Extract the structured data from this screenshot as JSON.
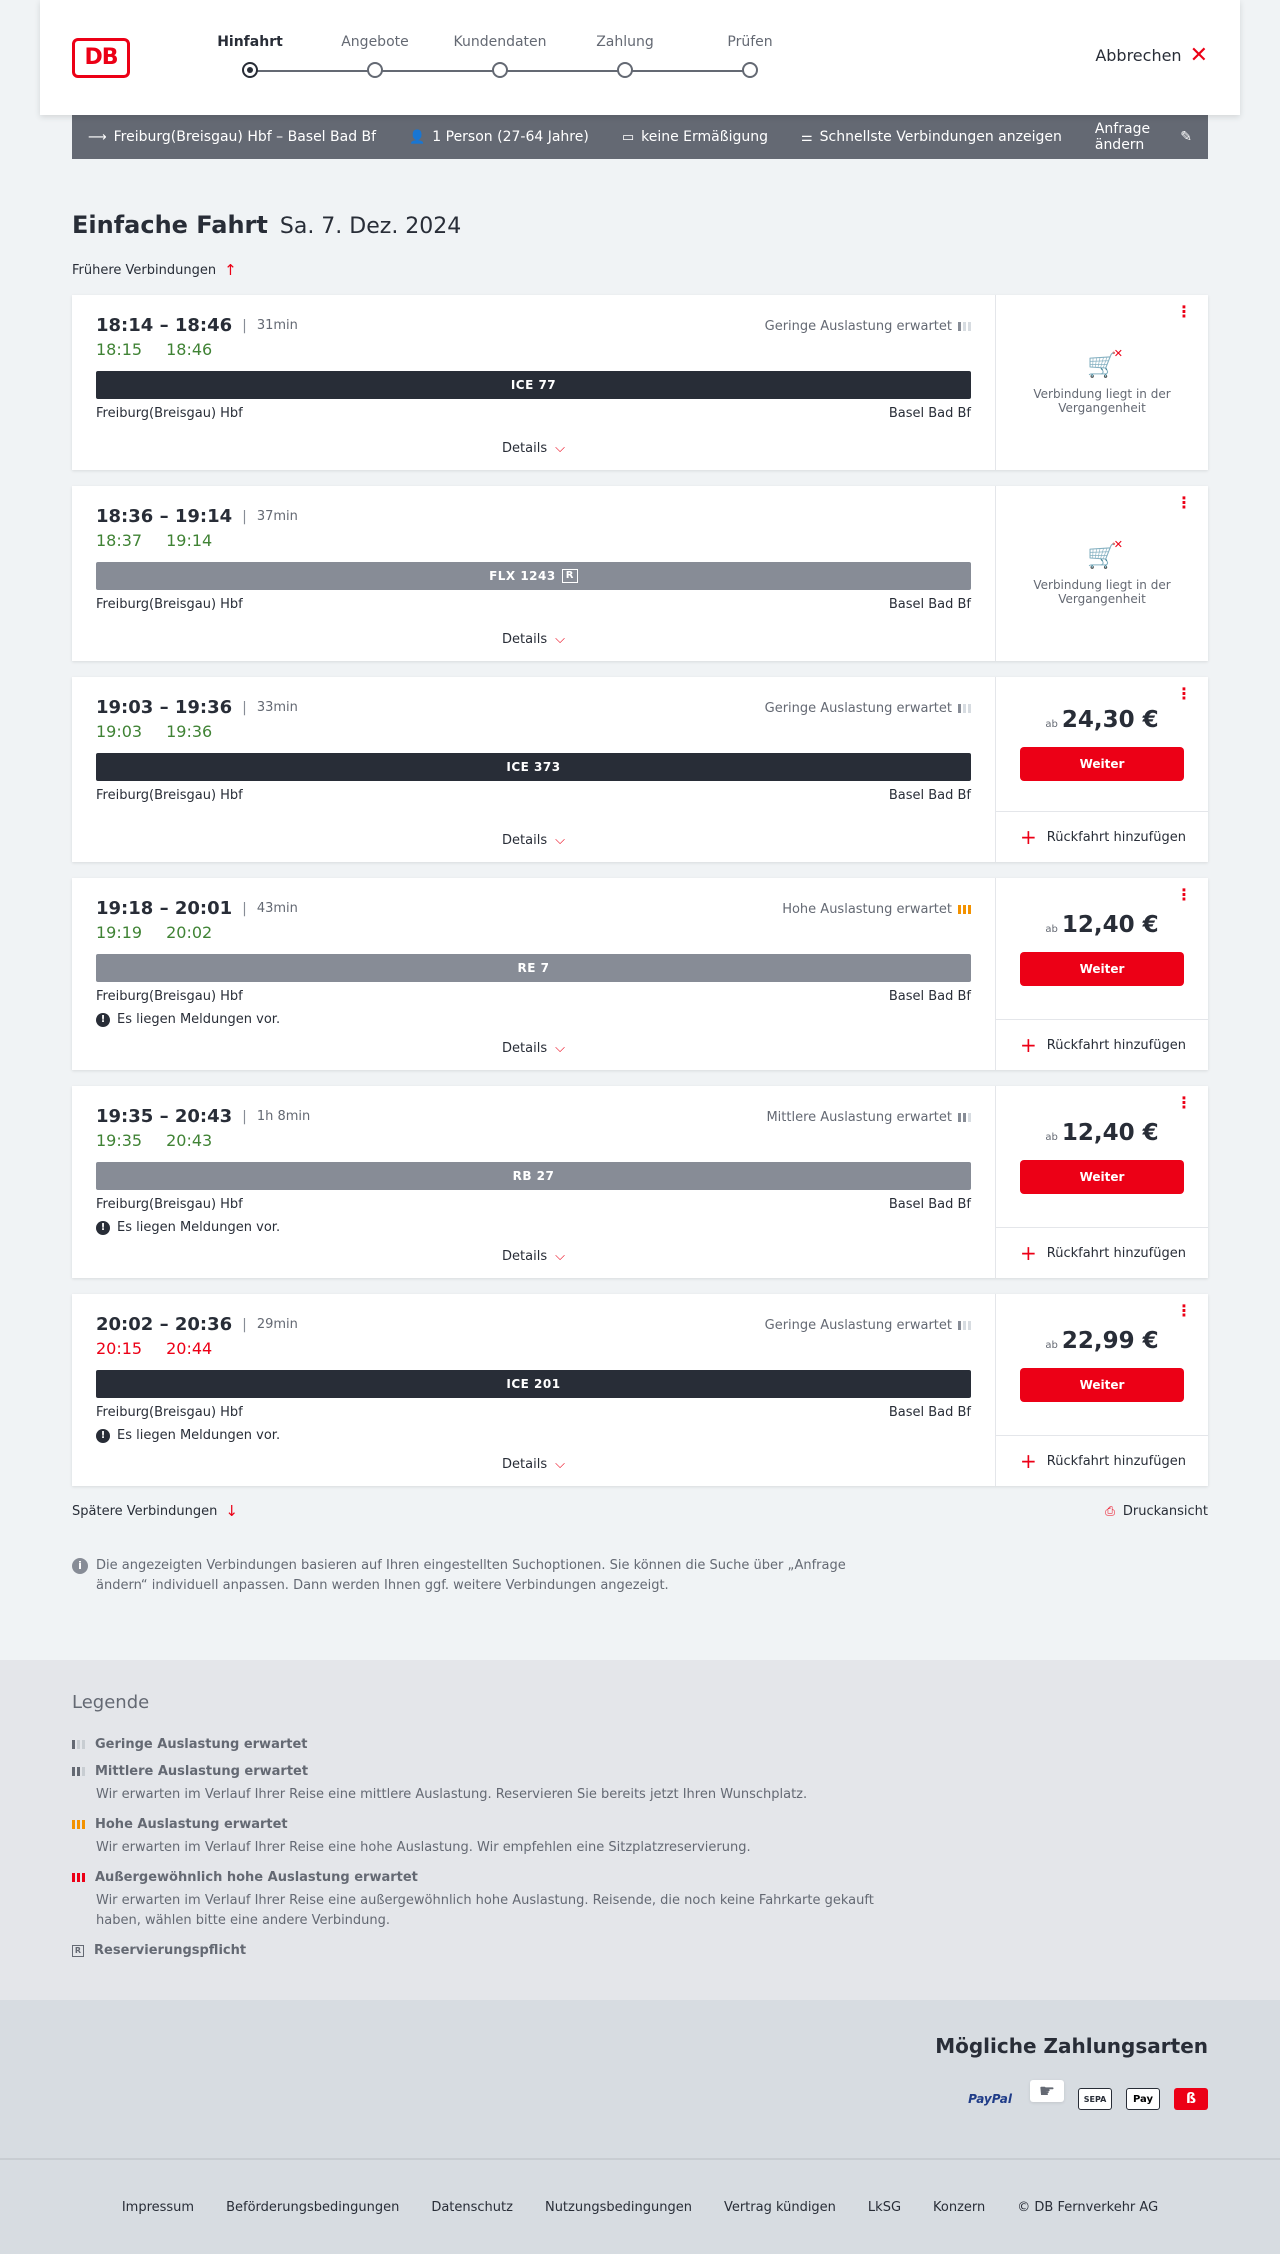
{
  "header": {
    "logo": "DB",
    "steps": [
      "Hinfahrt",
      "Angebote",
      "Kundendaten",
      "Zahlung",
      "Prüfen"
    ],
    "cancel_label": "Abbrechen"
  },
  "query": {
    "route": "Freiburg(Breisgau) Hbf – Basel Bad Bf",
    "passengers": "1 Person (27-64 Jahre)",
    "discount": "keine Ermäßigung",
    "option": "Schnellste Verbindungen anzeigen",
    "change_label": "Anfrage ändern"
  },
  "title": "Einfache Fahrt",
  "date": "Sa. 7. Dez. 2024",
  "earlier_label": "Frühere Verbindungen",
  "later_label": "Spätere Verbindungen",
  "print_label": "Druckansicht",
  "details_label": "Details",
  "price_prefix": "ab",
  "weiter_label": "Weiter",
  "return_label": "Rückfahrt hinzufügen",
  "past_text": "Verbindung liegt in der Vergangenheit",
  "message_text": "Es liegen Meldungen vor.",
  "connections": [
    {
      "times": "18:14 – 18:46",
      "duration": "31min",
      "rt_dep": "18:15",
      "rt_arr": "18:46",
      "rt_status": "ok",
      "load": "Geringe Auslastung erwartet",
      "train": "ICE 77",
      "from": "Freiburg(Breisgau) Hbf",
      "to": "Basel Bad Bf"
    },
    {
      "times": "18:36 – 19:14",
      "duration": "37min",
      "rt_dep": "18:37",
      "rt_arr": "19:14",
      "rt_status": "ok",
      "load": "",
      "train": "FLX 1243",
      "from": "Freiburg(Breisgau) Hbf",
      "to": "Basel Bad Bf"
    },
    {
      "times": "19:03 – 19:36",
      "duration": "33min",
      "rt_dep": "19:03",
      "rt_arr": "19:36",
      "rt_status": "ok",
      "load": "Geringe Auslastung erwartet",
      "train": "ICE 373",
      "from": "Freiburg(Breisgau) Hbf",
      "to": "Basel Bad Bf",
      "price": "24,30 €"
    },
    {
      "times": "19:18 – 20:01",
      "duration": "43min",
      "rt_dep": "19:19",
      "rt_arr": "20:02",
      "rt_status": "ok",
      "load": "Hohe Auslastung erwartet",
      "train": "RE 7",
      "from": "Freiburg(Breisgau) Hbf",
      "to": "Basel Bad Bf",
      "price": "12,40 €"
    },
    {
      "times": "19:35 – 20:43",
      "duration": "1h 8min",
      "rt_dep": "19:35",
      "rt_arr": "20:43",
      "rt_status": "ok",
      "load": "Mittlere Auslastung erwartet",
      "train": "RB 27",
      "from": "Freiburg(Breisgau) Hbf",
      "to": "Basel Bad Bf",
      "price": "12,40 €"
    },
    {
      "times": "20:02 – 20:36",
      "duration": "29min",
      "rt_dep": "20:15",
      "rt_arr": "20:44",
      "rt_status": "late",
      "load": "Geringe Auslastung erwartet",
      "train": "ICE 201",
      "from": "Freiburg(Breisgau) Hbf",
      "to": "Basel Bad Bf",
      "price": "22,99 €"
    }
  ],
  "info_text": "Die angezeigten Verbindungen basieren auf Ihren eingestellten Suchoptionen. Sie können die Suche über „Anfrage ändern“ individuell anpassen. Dann werden Ihnen ggf. weitere Verbindungen angezeigt.",
  "legend": {
    "title": "Legende",
    "items": [
      {
        "title": "Geringe Auslastung erwartet",
        "desc": ""
      },
      {
        "title": "Mittlere Auslastung erwartet",
        "desc": "Wir erwarten im Verlauf Ihrer Reise eine mittlere Auslastung. Reservieren Sie bereits jetzt Ihren Wunschplatz."
      },
      {
        "title": "Hohe Auslastung erwartet",
        "desc": "Wir erwarten im Verlauf Ihrer Reise eine hohe Auslastung. Wir empfehlen eine Sitzplatzreservierung."
      },
      {
        "title": "Außergewöhnlich hohe Auslastung erwartet",
        "desc": "Wir erwarten im Verlauf Ihrer Reise eine außergewöhnlich hohe Auslastung. Reisende, die noch keine Fahrkarte gekauft haben, wählen bitte eine andere Verbindung."
      },
      {
        "title": "Reservierungspflicht",
        "desc": ""
      }
    ]
  },
  "payment": {
    "title": "Mögliche Zahlungsarten",
    "paypal": "PayPal",
    "sepa": "SEPA",
    "apple": "Pay"
  },
  "footer": [
    "Impressum",
    "Beförderungsbedingungen",
    "Datenschutz",
    "Nutzungsbedingungen",
    "Vertrag kündigen",
    "LkSG",
    "Konzern",
    "© DB Fernverkehr AG"
  ],
  "colors": {
    "accent": "#ec0016",
    "ontime": "#408335",
    "dark": "#282d37",
    "high_load": "#f39200"
  },
  "icons": [
    "arrow-right-icon",
    "person-icon",
    "card-icon",
    "sliders-icon",
    "pencil-icon",
    "close-icon",
    "arrow-up-icon",
    "arrow-down-icon",
    "chevron-down-icon",
    "kebab-icon",
    "cart-icon",
    "plus-icon",
    "print-icon",
    "info-icon",
    "alert-icon",
    "load-bars-icon"
  ]
}
